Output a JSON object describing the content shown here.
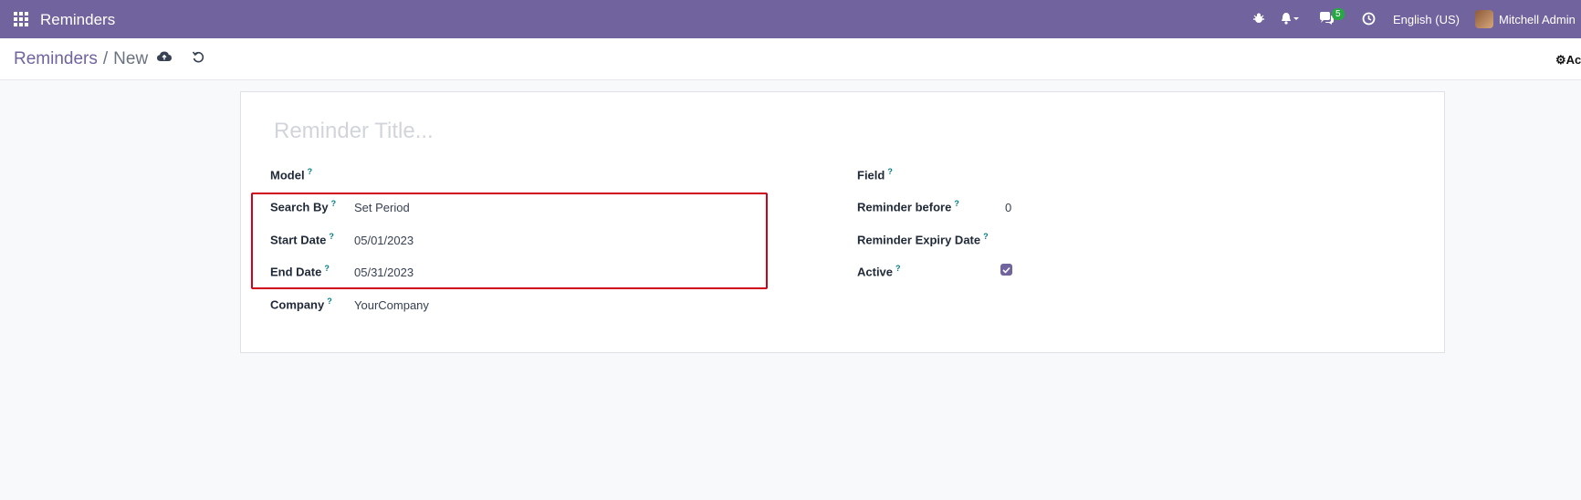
{
  "navbar": {
    "app_title": "Reminders",
    "message_count": "5",
    "language": "English (US)",
    "user_name": "Mitchell Admin"
  },
  "control": {
    "breadcrumb_parent": "Reminders",
    "breadcrumb_separator": "/",
    "breadcrumb_current": "New",
    "action_label": "Ac"
  },
  "form": {
    "title_placeholder": "Reminder Title...",
    "left": {
      "model_label": "Model",
      "search_by_label": "Search By",
      "search_by_value": "Set Period",
      "start_date_label": "Start Date",
      "start_date_value": "05/01/2023",
      "end_date_label": "End Date",
      "end_date_value": "05/31/2023",
      "company_label": "Company",
      "company_value": "YourCompany"
    },
    "right": {
      "field_label": "Field",
      "reminder_before_label": "Reminder before",
      "reminder_before_value": "0",
      "expiry_label": "Reminder Expiry Date",
      "active_label": "Active",
      "active_checked": true
    },
    "help_mark": "?"
  },
  "colors": {
    "brand": "#71639e",
    "highlight_border": "#d0021b",
    "badge": "#28a745"
  }
}
